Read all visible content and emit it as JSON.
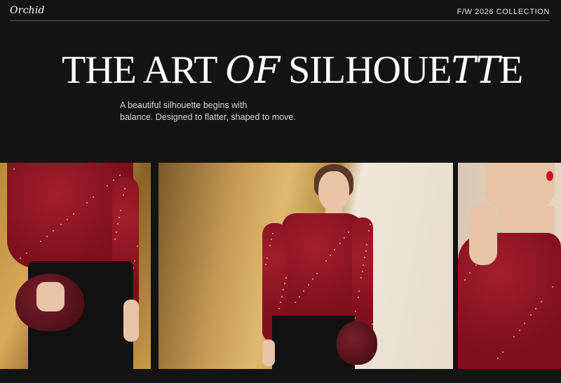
{
  "header": {
    "logo_text": "Orchid",
    "collection": "F/W 2026 COLLECTION"
  },
  "hero": {
    "headline_part1": "THE ART ",
    "headline_script1": "OF",
    "headline_part2": " SILHOUE",
    "headline_script2": "TT",
    "headline_part3": "E",
    "subtitle_line1": "A beautiful silhouette begins with",
    "subtitle_line2": "balance. Designed to flatter, shaped to move."
  },
  "colors": {
    "background": "#141414",
    "accent_red": "#8b1320",
    "gold": "#c99a4c"
  },
  "images": [
    {
      "name": "model-left-crop",
      "subject": "red sparkle draped top with woven bag"
    },
    {
      "name": "model-center",
      "subject": "model in red sparkle top and black skirt"
    },
    {
      "name": "model-right-crop",
      "subject": "close-up of model face and red top"
    }
  ]
}
